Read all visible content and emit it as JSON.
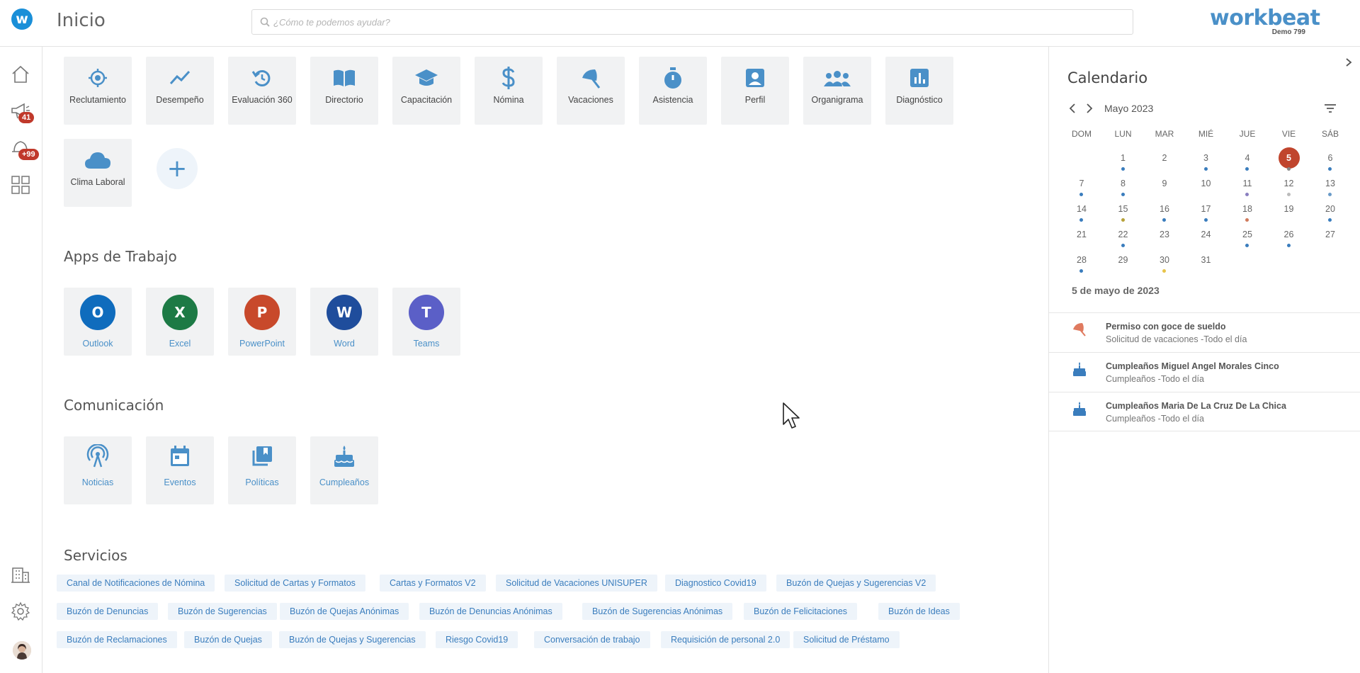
{
  "header": {
    "logo_letter": "w",
    "title": "Inicio",
    "search_placeholder": "¿Cómo te podemos ayudar?",
    "brand_name": "workbeat",
    "brand_sub": "Demo 799"
  },
  "leftnav": {
    "items": [
      {
        "name": "home-icon"
      },
      {
        "name": "megaphone-icon",
        "badge": "41"
      },
      {
        "name": "notifications-icon",
        "badge": "+99"
      },
      {
        "name": "apps-grid-icon"
      },
      {
        "name": "building-icon"
      },
      {
        "name": "gear-icon"
      }
    ]
  },
  "modules": [
    {
      "label": "Reclutamiento",
      "icon": "target-icon"
    },
    {
      "label": "Desempeño",
      "icon": "trend-icon"
    },
    {
      "label": "Evaluación 360",
      "icon": "refresh-icon"
    },
    {
      "label": "Directorio",
      "icon": "book-icon"
    },
    {
      "label": "Capacitación",
      "icon": "graduation-cap-icon"
    },
    {
      "label": "Nómina",
      "icon": "dollar-icon"
    },
    {
      "label": "Vacaciones",
      "icon": "umbrella-icon"
    },
    {
      "label": "Asistencia",
      "icon": "stopwatch-icon"
    },
    {
      "label": "Perfil",
      "icon": "profile-card-icon"
    },
    {
      "label": "Organigrama",
      "icon": "people-icon"
    },
    {
      "label": "Diagnóstico",
      "icon": "bar-chart-icon"
    },
    {
      "label": "Clima Laboral",
      "icon": "cloud-icon"
    }
  ],
  "add_button": "+",
  "sections": {
    "work_apps": "Apps de Trabajo",
    "communication": "Comunicación",
    "services": "Servicios"
  },
  "work_apps": [
    {
      "label": "Outlook",
      "letter": "O",
      "color": "#0f6cbd"
    },
    {
      "label": "Excel",
      "letter": "X",
      "color": "#1d7a45"
    },
    {
      "label": "PowerPoint",
      "letter": "P",
      "color": "#c8492b"
    },
    {
      "label": "Word",
      "letter": "W",
      "color": "#1f4d9c"
    },
    {
      "label": "Teams",
      "letter": "T",
      "color": "#5b5fc7"
    }
  ],
  "communication": [
    {
      "label": "Noticias",
      "icon": "broadcast-icon"
    },
    {
      "label": "Eventos",
      "icon": "calendar-icon"
    },
    {
      "label": "Políticas",
      "icon": "documents-icon"
    },
    {
      "label": "Cumpleaños",
      "icon": "cake-icon"
    }
  ],
  "services": [
    [
      "Canal de Notificaciones de Nómina",
      "Solicitud de Cartas y Formatos",
      "Cartas y Formatos V2",
      "Solicitud de Vacaciones UNISUPER",
      "Diagnostico Covid19",
      "Buzón de Quejas y Sugerencias V2"
    ],
    [
      "Buzón de Denuncias",
      "Buzón de Sugerencias",
      "Buzón de Quejas Anónimas",
      "Buzón de Denuncias Anónimas",
      "Buzón de Sugerencias Anónimas",
      "Buzón de Felicitaciones",
      "Buzón de Ideas"
    ],
    [
      "Buzón de Reclamaciones",
      "Buzón de Quejas",
      "Buzón de Quejas y Sugerencias",
      "Riesgo Covid19",
      "Conversación de trabajo",
      "Requisición de personal 2.0",
      "Solicitud de Préstamo"
    ]
  ],
  "calendar": {
    "title": "Calendario",
    "month": "Mayo 2023",
    "weekdays": [
      "DOM",
      "LUN",
      "MAR",
      "MIÉ",
      "JUE",
      "VIE",
      "SÁB"
    ],
    "first_weekday": 1,
    "days_in_month": 31,
    "today": 5,
    "dots": {
      "1": "#3a7dbd",
      "3": "#3a7dbd",
      "4": "#3a7dbd",
      "5": "#888888",
      "6": "#3a7dbd",
      "7": "#3a7dbd",
      "8": "#3a7dbd",
      "11": "#8a7fc0",
      "12": "#bbbbbb",
      "13": "#6a9bc8",
      "14": "#3a7dbd",
      "15": "#b7a23a",
      "16": "#3a7dbd",
      "17": "#3a7dbd",
      "18": "#d07a5c",
      "20": "#3a7dbd",
      "22": "#3a7dbd",
      "25": "#3a7dbd",
      "26": "#3a7dbd",
      "28": "#3a7dbd",
      "30": "#e8c44a"
    },
    "selected_date": "5 de mayo de 2023",
    "events": [
      {
        "title": "Permiso con goce de sueldo",
        "subtitle": "Solicitud de vacaciones -Todo el día",
        "icon": "umbrella-icon"
      },
      {
        "title": "Cumpleaños Miguel Angel Morales Cinco",
        "subtitle": "Cumpleaños -Todo el día",
        "icon": "cake-icon"
      },
      {
        "title": "Cumpleaños Maria De La Cruz De La Chica",
        "subtitle": "Cumpleaños -Todo el día",
        "icon": "cake-icon"
      }
    ]
  },
  "colors": {
    "accent": "#4a90c8",
    "badge": "#c0392b",
    "today": "#c0452d"
  }
}
